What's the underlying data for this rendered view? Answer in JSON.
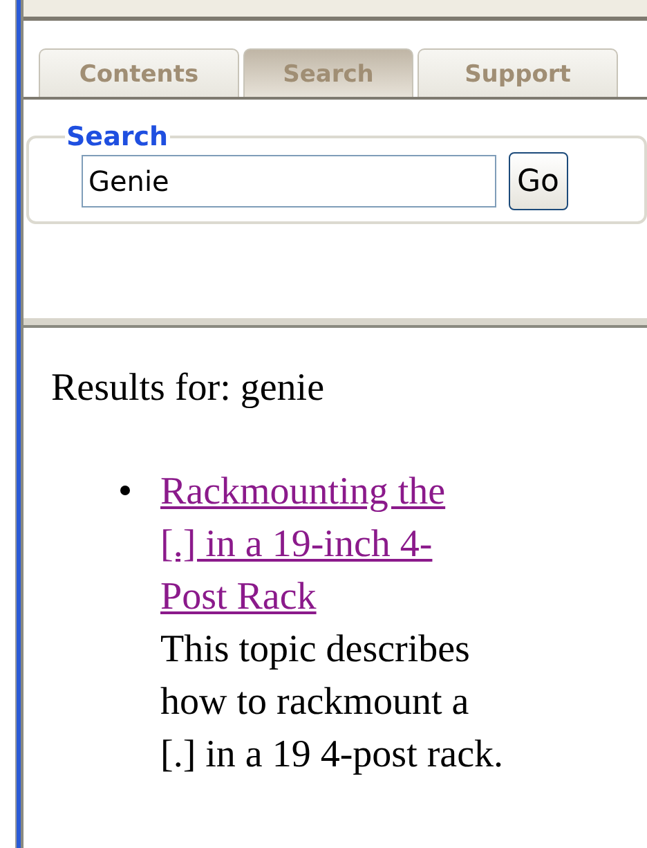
{
  "tabs": [
    {
      "label": "Contents",
      "selected": false
    },
    {
      "label": "Search",
      "selected": true
    },
    {
      "label": "Support",
      "selected": false
    }
  ],
  "search": {
    "legend": "Search",
    "value": "Genie",
    "button": "Go"
  },
  "results": {
    "heading": "Results for: genie",
    "items": [
      {
        "title": "Rackmounting the [.] in a 19-inch 4-Post Rack",
        "description": "This topic describes how to rackmount a [.] in a 19 4-post rack."
      }
    ]
  }
}
